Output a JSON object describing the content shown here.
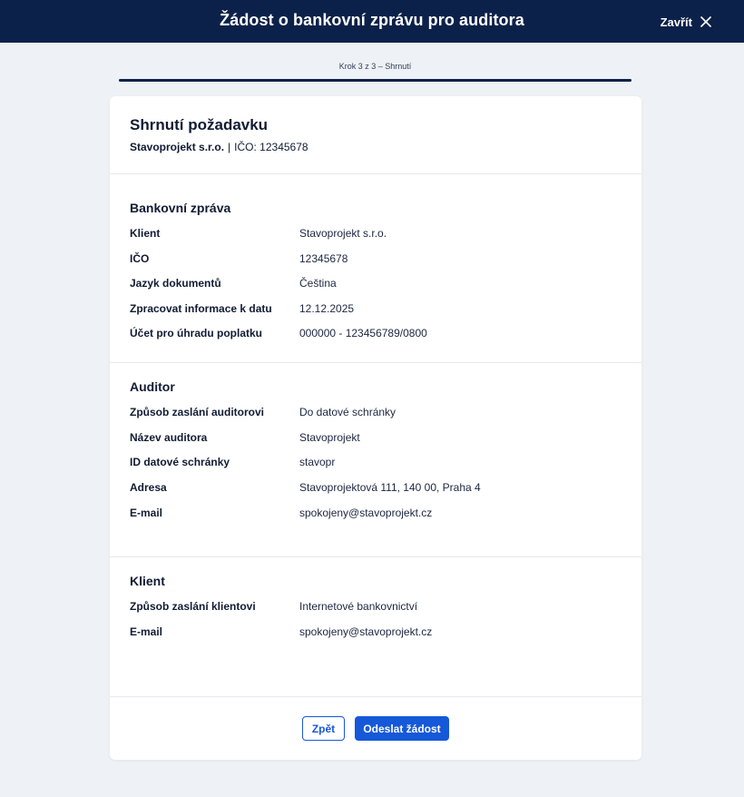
{
  "header": {
    "title": "Žádost o bankovní zprávu pro auditora",
    "close_label": "Zavřít",
    "close_icon": "close-icon"
  },
  "stepper": {
    "text": "Krok 3 z 3 – Shrnutí",
    "current": 3,
    "total": 3,
    "progress": 1.0
  },
  "summary": {
    "title": "Shrnutí požadavku",
    "company": "Stavoprojekt s.r.o.",
    "separator": "|",
    "ico": "IČO: 12345678"
  },
  "sections": {
    "bank_report": {
      "title": "Bankovní zpráva",
      "rows": [
        {
          "label": "Klient",
          "value": "Stavoprojekt s.r.o."
        },
        {
          "label": "IČO",
          "value": "12345678"
        },
        {
          "label": "Jazyk dokumentů",
          "value": "Čeština"
        },
        {
          "label": "Zpracovat informace k datu",
          "value": "12.12.2025"
        },
        {
          "label": "Účet pro úhradu poplatku",
          "value": "000000 - 123456789/0800"
        }
      ]
    },
    "auditor": {
      "title": "Auditor",
      "rows": [
        {
          "label": "Způsob zaslání auditorovi",
          "value": "Do datové schránky"
        },
        {
          "label": "Název auditora",
          "value": "Stavoprojekt"
        },
        {
          "label": "ID datové schránky",
          "value": "stavopr"
        },
        {
          "label": "Adresa",
          "value": "Stavoprojektová 111, 140 00, Praha 4"
        },
        {
          "label": "E-mail",
          "value": "spokojeny@stavoprojekt.cz"
        }
      ]
    },
    "client": {
      "title": "Klient",
      "rows": [
        {
          "label": "Způsob zaslání klientovi",
          "value": "Internetové bankovnictví"
        },
        {
          "label": "E-mail",
          "value": "spokojeny@stavoprojekt.cz"
        }
      ]
    }
  },
  "actions": {
    "back_label": "Zpět",
    "submit_label": "Odeslat žádost"
  },
  "colors": {
    "header_bg": "#0c2149",
    "page_bg": "#eef1f5",
    "primary": "#1559d8"
  }
}
